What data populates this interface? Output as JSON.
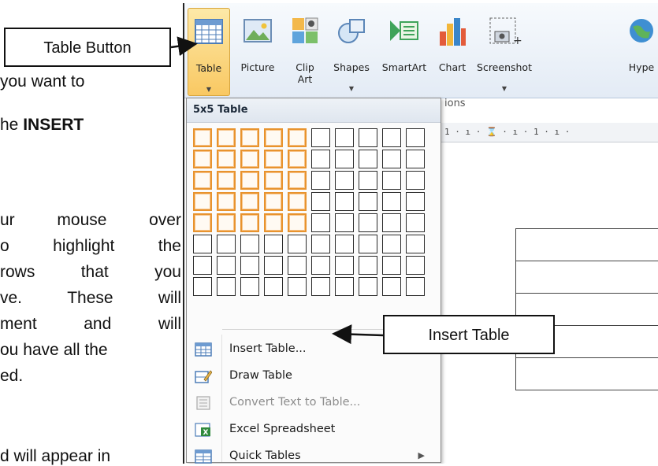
{
  "document_text": {
    "line1": "you want to",
    "line2_prefix": "he ",
    "line2_bold": "INSERT",
    "line3": [
      "ur",
      "mouse",
      "over"
    ],
    "line4": [
      "o",
      "highlight",
      "the"
    ],
    "line5": [
      "rows",
      "that",
      "you"
    ],
    "line6": [
      "ve.",
      "These",
      "will"
    ],
    "line7": [
      "ment",
      "and",
      "will"
    ],
    "line8": "ou have all the",
    "line9": "ed.",
    "line10": "d   will appear in"
  },
  "ribbon": {
    "buttons": [
      {
        "label": "Table",
        "icon": "table-icon"
      },
      {
        "label": "Picture",
        "icon": "picture-icon"
      },
      {
        "label": "Clip\nArt",
        "icon": "clip-art-icon"
      },
      {
        "label": "Shapes",
        "icon": "shapes-icon"
      },
      {
        "label": "SmartArt",
        "icon": "smartart-icon"
      },
      {
        "label": "Chart",
        "icon": "chart-icon"
      },
      {
        "label": "Screenshot",
        "icon": "screenshot-icon"
      },
      {
        "label": "Hype",
        "icon": "hyperlink-icon"
      }
    ],
    "group_label": "ions",
    "ruler_text": "1 · ı · ⌛ · ı · 1 · ı ·"
  },
  "menu": {
    "title": "5x5 Table",
    "grid": {
      "cols": 10,
      "rows": 8,
      "selected_cols": 5,
      "selected_rows": 5
    },
    "items": [
      {
        "label": "Insert Table...",
        "icon": "insert-table-icon",
        "disabled": false
      },
      {
        "label": "Draw Table",
        "icon": "draw-table-icon",
        "disabled": false
      },
      {
        "label": "Convert Text to Table...",
        "icon": "convert-text-icon",
        "disabled": true
      },
      {
        "label": "Excel Spreadsheet",
        "icon": "excel-spreadsheet-icon",
        "disabled": false
      },
      {
        "label": "Quick Tables",
        "icon": "quick-tables-icon",
        "disabled": false,
        "submenu": true
      }
    ]
  },
  "callouts": {
    "table_button": "Table Button",
    "insert_table": "Insert Table"
  },
  "colors": {
    "highlight_border": "#e8932e",
    "ribbon_active": "#f9c862"
  }
}
